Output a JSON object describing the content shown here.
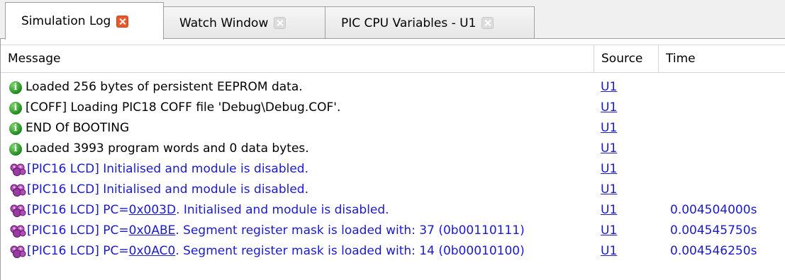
{
  "tabs": [
    {
      "label": "Simulation Log",
      "active": true
    },
    {
      "label": "Watch Window",
      "active": false
    },
    {
      "label": "PIC CPU Variables - U1",
      "active": false
    }
  ],
  "columns": {
    "message": "Message",
    "source": "Source",
    "time": "Time"
  },
  "log": [
    {
      "icon": "info-icon",
      "message": "Loaded 256 bytes of persistent EEPROM data.",
      "source": "U1",
      "time": ""
    },
    {
      "icon": "info-icon",
      "message": "[COFF] Loading PIC18 COFF file 'Debug\\Debug.COF'.",
      "source": "U1",
      "time": ""
    },
    {
      "icon": "info-icon",
      "message": "END Of BOOTING",
      "source": "U1",
      "time": ""
    },
    {
      "icon": "info-icon",
      "message": "Loaded 3993 program words and 0 data bytes.",
      "source": "U1",
      "time": ""
    },
    {
      "icon": "lcd-chip-icon",
      "message": "[PIC16 LCD] Initialised and module is disabled.",
      "source": "U1",
      "time": ""
    },
    {
      "icon": "lcd-chip-icon",
      "message": "[PIC16 LCD] Initialised and module is disabled.",
      "source": "U1",
      "time": ""
    },
    {
      "icon": "lcd-chip-icon",
      "prefix": "[PIC16 LCD] PC=",
      "pc": "0x003D",
      "suffix": ". Initialised and module is disabled.",
      "source": "U1",
      "time": "0.004504000s"
    },
    {
      "icon": "lcd-chip-icon",
      "prefix": "[PIC16 LCD] PC=",
      "pc": "0x0ABE",
      "suffix": ". Segment register mask is loaded with: 37 (0b00110111)",
      "source": "U1",
      "time": "0.004545750s"
    },
    {
      "icon": "lcd-chip-icon",
      "prefix": "[PIC16 LCD] PC=",
      "pc": "0x0AC0",
      "suffix": ". Segment register mask is loaded with: 14 (0b00010100)",
      "source": "U1",
      "time": "0.004546250s"
    }
  ]
}
